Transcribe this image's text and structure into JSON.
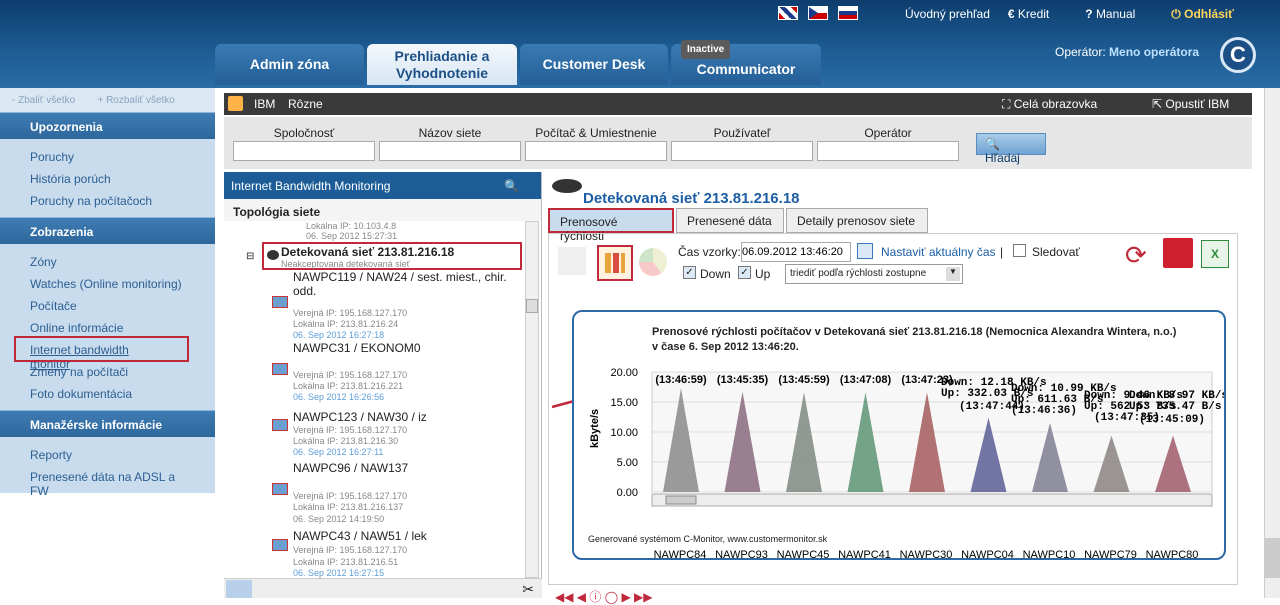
{
  "header": {
    "links": [
      "Úvodný prehľad",
      "Kredit",
      "Manual",
      "Odhlásiť"
    ],
    "tabs": [
      {
        "label": "Admin zóna"
      },
      {
        "label": "Prehliadanie a Vyhodnotenie"
      },
      {
        "label": "Customer Desk"
      },
      {
        "label": "Communicator",
        "badge": "Inactive"
      }
    ],
    "operator_label": "Operátor:",
    "operator_name": "Meno operátora",
    "logo": "C"
  },
  "sidebar": {
    "collapse_all": "- Zbaliť všetko",
    "expand_all": "+ Rozbaliť všetko",
    "sections": [
      {
        "title": "Upozornenia",
        "items": [
          "Poruchy",
          "História porúch",
          "Poruchy na počítačoch"
        ]
      },
      {
        "title": "Zobrazenia",
        "items": [
          "Zóny",
          "Watches (Online monitoring)",
          "Počítače",
          "Online informácie",
          "Internet bandwidth monitor",
          "Zmeny na počítači",
          "Foto dokumentácia"
        ]
      },
      {
        "title": "Manažérske informácie",
        "items": [
          "Reporty",
          "Prenesené dáta na ADSL a FW"
        ]
      }
    ]
  },
  "breadcrumb": {
    "items": [
      "IBM",
      "Rôzne"
    ],
    "fullscreen": "Celá obrazovka",
    "exit": "Opustiť IBM"
  },
  "filters": {
    "labels": [
      "Spoločnosť",
      "Názov siete",
      "Počítač & Umiestnenie",
      "Používateľ",
      "Operátor"
    ],
    "search_label": "Hľadaj"
  },
  "tree": {
    "header": "Internet Bandwidth Monitoring",
    "title": "Topológia siete",
    "top_clip": "Lokálna IP: 10.103.4.8",
    "top_clip_date": "06. Sep 2012 15:27:31",
    "selected": "Detekovaná sieť 213.81.216.18",
    "selected_sub": "Neakceptovaná detekovaná sieť",
    "nodes": [
      {
        "name": "NAWPC119 / NAW24 / sest. miest., chir. odd.",
        "ip1": "Verejná IP: 195.168.127.170",
        "ip2": "Lokálna IP: 213.81.216.24",
        "date": "06. Sep 2012 16:27:18"
      },
      {
        "name": "NAWPC31 / EKONOM0",
        "ip1": "Verejná IP: 195.168.127.170",
        "ip2": "Lokálna IP: 213.81.216.221",
        "date": "06. Sep 2012 16:26:56"
      },
      {
        "name": "NAWPC123 / NAW30 / iz",
        "ip1": "Verejná IP: 195.168.127.170",
        "ip2": "Lokálna IP: 213.81.216.30",
        "date": "06. Sep 2012 16:27:11"
      },
      {
        "name": "NAWPC96 / NAW137",
        "ip1": "Verejná IP: 195.168.127.170",
        "ip2": "Lokálna IP: 213.81.216.137",
        "date": "06. Sep 2012 14:19:50"
      },
      {
        "name": "NAWPC43 / NAW51 / lek",
        "ip1": "Verejná IP: 195.168.127.170",
        "ip2": "Lokálna IP: 213.81.216.51",
        "date": "06. Sep 2012 16:27:15"
      }
    ]
  },
  "detail": {
    "title": "Detekovaná sieť 213.81.216.18",
    "tabs": [
      "Prenosové rýchlosti",
      "Prenesené dáta",
      "Detaily prenosov siete"
    ],
    "time_label": "Čas vzorky:",
    "time_value": "06.09.2012 13:46:20",
    "set_current": "Nastaviť aktuálny čas",
    "follow": "Sledovať",
    "down": "Down",
    "up": "Up",
    "sort": "triediť podľa rýchlosti zostupne",
    "footer": "Generované systémom C-Monitor, www.customermonitor.sk"
  },
  "chart_data": {
    "type": "bar",
    "title": "Prenosové rýchlosti počítačov v Detekovaná sieť 213.81.216.18 (Nemocnica Alexandra Wintera, n.o.)",
    "subtitle": "v čase 6. Sep 2012 13:46:20.",
    "ylabel": "kByte/s",
    "ylim": [
      0,
      20
    ],
    "yticks": [
      "0.00",
      "5.00",
      "10.00",
      "15.00",
      "20.00"
    ],
    "categories": [
      "NAWPC84",
      "NAWPC93",
      "NAWPC45",
      "NAWPC41",
      "NAWPC30",
      "NAWPC04",
      "NAWPC10",
      "NAWPC79",
      "NAWPC80"
    ],
    "values": [
      17.3,
      16.7,
      16.6,
      16.6,
      16.6,
      12.4,
      11.5,
      9.4,
      9.4
    ],
    "colors": [
      "#8a8a8a",
      "#8a6a7e",
      "#7f8a80",
      "#5d9474",
      "#a35a5a",
      "#5a5d94",
      "#7e7e90",
      "#8a8280",
      "#a05a6a"
    ],
    "top_labels": [
      "(13:46:59)",
      "(13:45:35)",
      "(13:45:59)",
      "(13:47:08)",
      "(13:47:23)"
    ],
    "annotations": [
      {
        "text": "Down: 12.18 KB/s"
      },
      {
        "text": "Up: 332.03 B/s"
      },
      {
        "text": "(13:47:44)"
      },
      {
        "text": "Down: 10.99 KB/s"
      },
      {
        "text": "Up: 611.63 B/s"
      },
      {
        "text": "(13:46:36)"
      },
      {
        "text": "Down: 9.46 KB/s"
      },
      {
        "text": "Up: 562.53 B/s"
      },
      {
        "text": "(13:47:35)"
      },
      {
        "text": "Down: 8.97 KB/s"
      },
      {
        "text": "Up: 735.47 B/s"
      },
      {
        "text": "(13:45:09)"
      }
    ]
  }
}
